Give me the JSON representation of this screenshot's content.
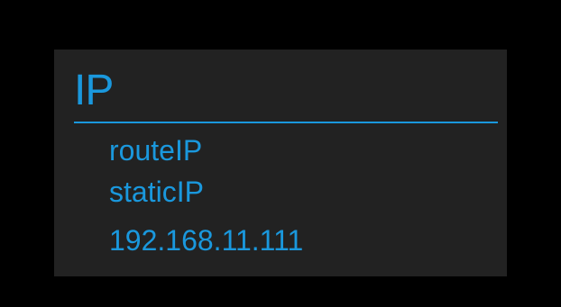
{
  "screen": {
    "title": "IP",
    "items": [
      {
        "label": "routeIP"
      },
      {
        "label": "staticIP"
      },
      {
        "label": "192.168.11.111"
      }
    ]
  },
  "colors": {
    "background": "#000000",
    "panel": "#222222",
    "accent": "#1a98dd"
  }
}
